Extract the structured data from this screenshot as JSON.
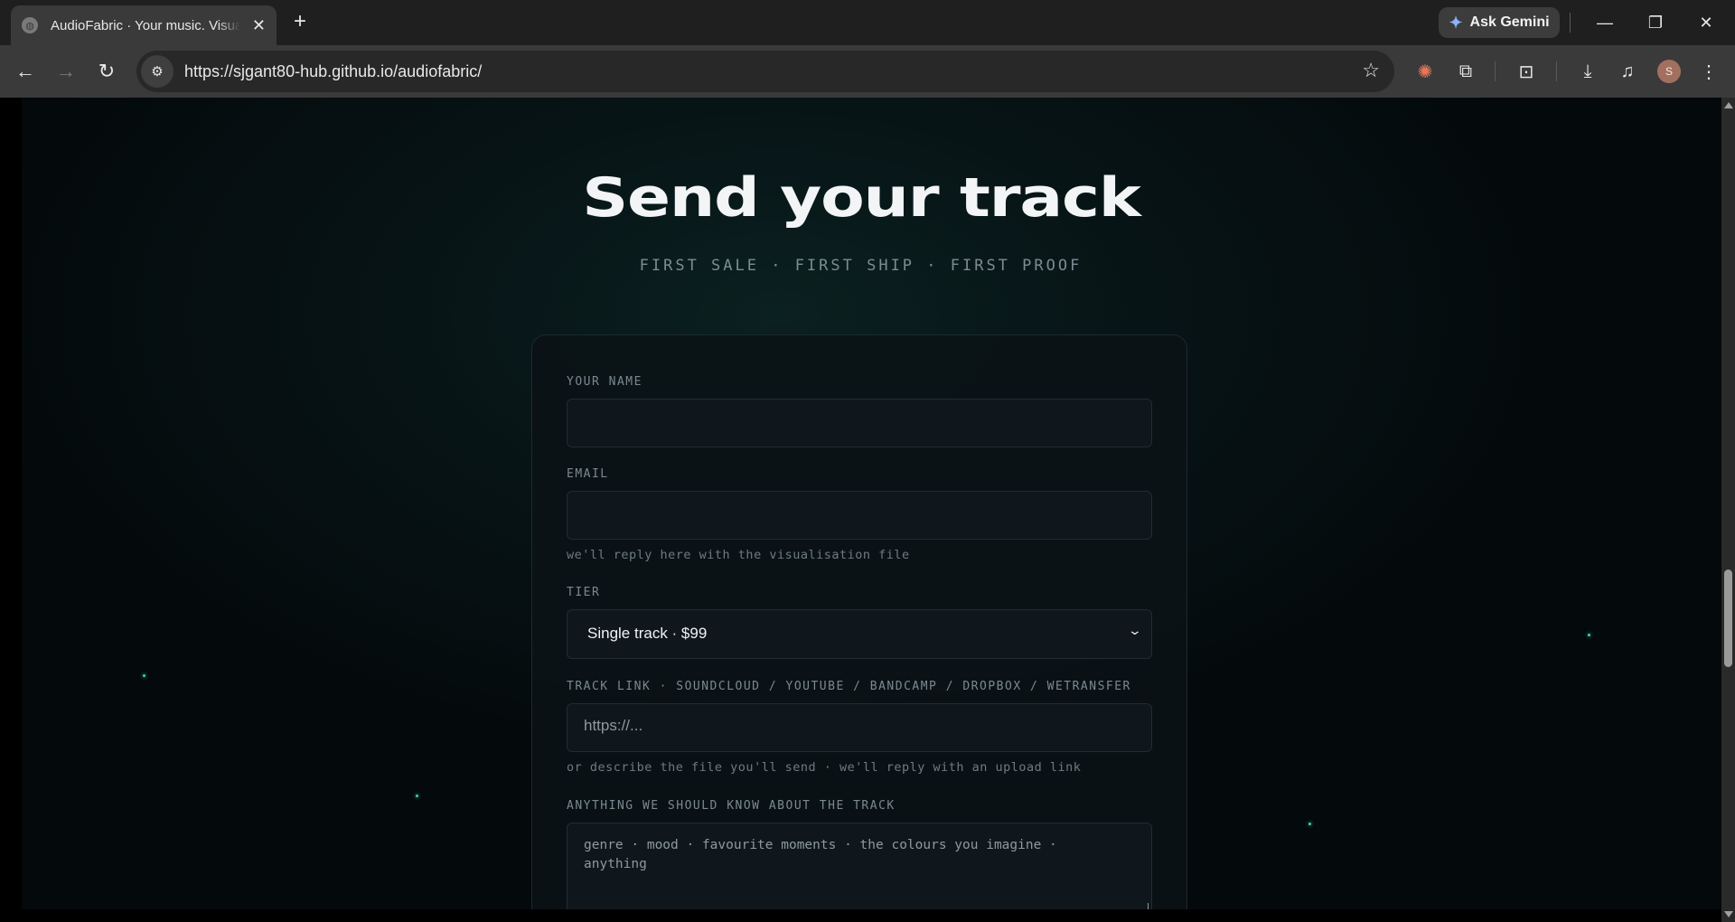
{
  "browser": {
    "tab": {
      "title": "AudioFabric · Your music. Visualised",
      "close_icon": "close-icon"
    },
    "new_tab_icon": "plus-icon",
    "gemini_label": "Ask Gemini",
    "address": "https://sjgant80-hub.github.io/audiofabric/",
    "profile_initial": "S"
  },
  "page": {
    "title": "Send your track",
    "subtitle": "FIRST SALE · FIRST SHIP · FIRST PROOF",
    "form": {
      "name_label": "YOUR NAME",
      "name_value": "",
      "email_label": "EMAIL",
      "email_value": "",
      "email_hint": "we'll reply here with the visualisation file",
      "tier_label": "TIER",
      "tier_selected": "Single track · $99",
      "link_label": "TRACK LINK · SOUNDCLOUD / YOUTUBE / BANDCAMP / DROPBOX / WETRANSFER",
      "link_placeholder": "https://...",
      "link_hint": "or describe the file you'll send · we'll reply with an upload link",
      "notes_label": "ANYTHING WE SHOULD KNOW ABOUT THE TRACK",
      "notes_placeholder": "genre · mood · favourite moments · the colours you imagine · anything"
    }
  },
  "colors": {
    "background": "#050a0c",
    "accent_dot": "#3ad0b0",
    "card": "#0b1216"
  }
}
